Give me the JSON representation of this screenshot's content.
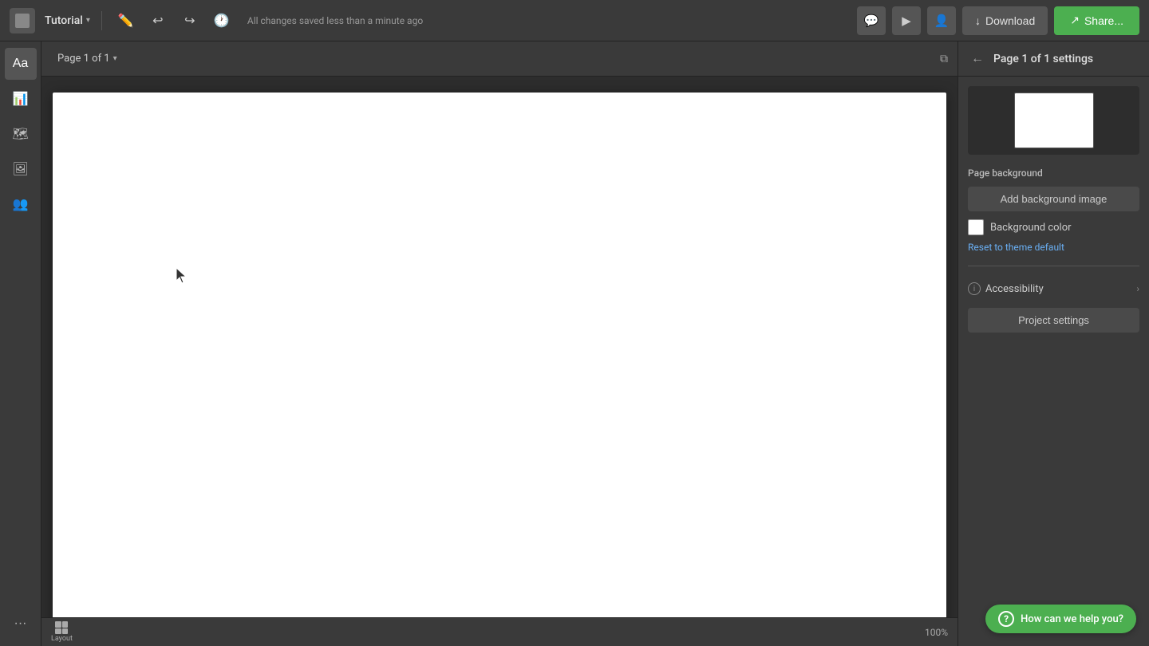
{
  "toolbar": {
    "project_name": "Tutorial",
    "autosave_text": "All changes saved less than a minute ago",
    "download_label": "Download",
    "share_label": "Share..."
  },
  "sidebar": {
    "items": [
      {
        "name": "text-tool",
        "icon": "Aa",
        "label": "Text"
      },
      {
        "name": "chart-tool",
        "icon": "📊",
        "label": "Charts"
      },
      {
        "name": "map-tool",
        "icon": "🗺",
        "label": "Maps"
      },
      {
        "name": "image-tool",
        "icon": "🖼",
        "label": "Images"
      },
      {
        "name": "team-tool",
        "icon": "👥",
        "label": "Team"
      },
      {
        "name": "more-tool",
        "icon": "···",
        "label": "More"
      }
    ]
  },
  "canvas": {
    "page_indicator": "Page 1 of 1",
    "zoom_level": "100%"
  },
  "right_panel": {
    "title": "Page 1 of 1 settings",
    "page_background_label": "Page background",
    "add_background_image_label": "Add background image",
    "background_color_label": "Background color",
    "reset_link_label": "Reset to theme default",
    "accessibility_label": "Accessibility",
    "project_settings_label": "Project settings"
  },
  "help": {
    "text": "How can we help you?"
  },
  "icons": {
    "back_arrow": "←",
    "chevron_down": "▾",
    "chevron_right": "›",
    "info": "i",
    "download_arrow": "↓",
    "share_arrow": "↗",
    "comment": "💬",
    "present": "▶",
    "collaborate": "👤",
    "undo": "↩",
    "redo": "↪",
    "layout_plus": "+"
  }
}
